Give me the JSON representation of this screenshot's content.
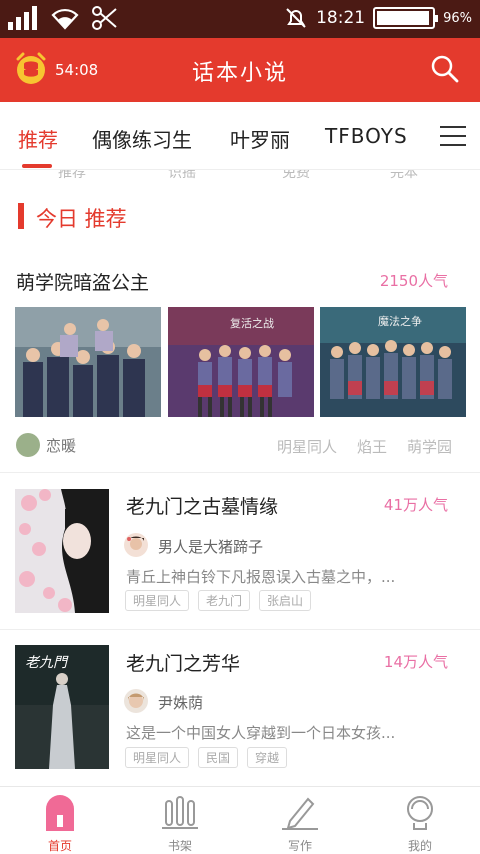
{
  "status_bar": {
    "time": "18:21",
    "battery": "96%",
    "battery_level": 0.96
  },
  "header": {
    "timer": "54:08",
    "title": "话本小说"
  },
  "tabs": [
    "推荐",
    "偶像练习生",
    "叶罗丽",
    "TFBOYS",
    "扌"
  ],
  "ghost_tabs": [
    "推荐",
    "识摇",
    "免费",
    "完本"
  ],
  "section": {
    "title": "今日 推荐"
  },
  "featured": {
    "title": "萌学院暗盗公主",
    "popularity": "2150人气",
    "author": "恋暖",
    "tags": [
      "明星同人",
      "焰王",
      "萌学园"
    ]
  },
  "items": [
    {
      "title": "老九门之古墓情缘",
      "popularity": "41万人气",
      "author": "男人是大猪蹄子",
      "desc": "青丘上神白铃下凡报恩误入古墓之中，...",
      "tags": [
        "明星同人",
        "老九门",
        "张启山"
      ]
    },
    {
      "title": "老九门之芳华",
      "popularity": "14万人气",
      "author": "尹姝荫",
      "desc": "这是一个中国女人穿越到一个日本女孩...",
      "tags": [
        "明星同人",
        "民国",
        "穿越"
      ],
      "cover_text": "老九門"
    }
  ],
  "nav": [
    "首页",
    "书架",
    "写作",
    "我的"
  ],
  "colors": {
    "brand": "#e43a2d",
    "status_bar": "#4b1a14",
    "popularity": "#e96fa4"
  }
}
